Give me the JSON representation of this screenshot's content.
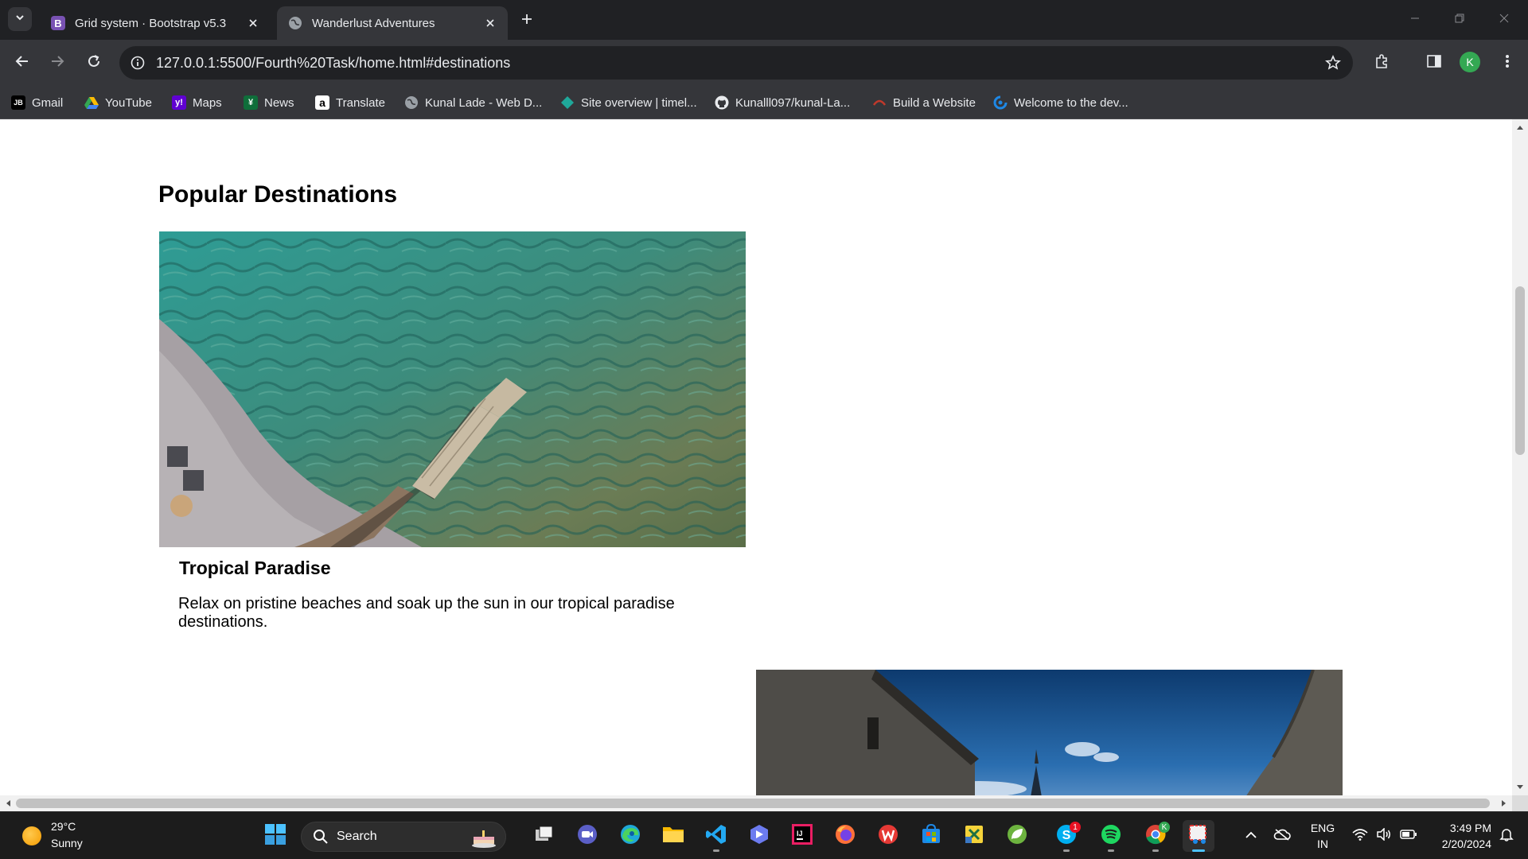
{
  "browser": {
    "tabs": [
      {
        "title": "Grid system · Bootstrap v5.3",
        "icon": "bootstrap-icon",
        "active": false
      },
      {
        "title": "Wanderlust Adventures",
        "icon": "globe-icon",
        "active": true
      }
    ],
    "url": "127.0.0.1:5500/Fourth%20Task/home.html#destinations",
    "profile_initial": "K",
    "bookmarks": [
      {
        "label": "Gmail",
        "icon": "jetbrains-icon"
      },
      {
        "label": "YouTube",
        "icon": "google-drive-icon"
      },
      {
        "label": "Maps",
        "icon": "yahoo-icon"
      },
      {
        "label": "News",
        "icon": "news-icon"
      },
      {
        "label": "Translate",
        "icon": "amazon-icon"
      },
      {
        "label": "Kunal Lade - Web D...",
        "icon": "globe-icon"
      },
      {
        "label": "Site overview | timel...",
        "icon": "diamond-icon"
      },
      {
        "label": "Kunalll097/kunal-La...",
        "icon": "github-icon"
      },
      {
        "label": "Build a Website",
        "icon": "website-builder-icon"
      },
      {
        "label": "Welcome to the dev...",
        "icon": "dev-icon"
      }
    ]
  },
  "page": {
    "section_title": "Popular Destinations",
    "cards": [
      {
        "title": "Tropical Paradise",
        "description": "Relax on pristine beaches and soak up the sun in our tropical paradise destinations.",
        "image": "aerial-beach-pier"
      },
      {
        "title": "",
        "description": "",
        "image": "stone-walls-church-sky"
      }
    ]
  },
  "taskbar": {
    "weather": {
      "temp": "29°C",
      "condition": "Sunny"
    },
    "search_label": "Search",
    "apps": [
      "task-view",
      "teams-meet",
      "edge",
      "file-explorer",
      "vscode",
      "copilot",
      "intellij",
      "firefox",
      "wps-office",
      "ms-store",
      "excel-python",
      "spring",
      "skype",
      "spotify",
      "chrome",
      "snipping-tool"
    ],
    "skype_badge": "1",
    "chrome_badge": "K",
    "language": {
      "line1": "ENG",
      "line2": "IN"
    },
    "clock": {
      "time": "3:49 PM",
      "date": "2/20/2024"
    }
  },
  "colors": {
    "tab_strip": "#202124",
    "toolbar": "#35363a",
    "page_bg": "#ffffff",
    "taskbar": "#1c1c1c",
    "accent_blue": "#4cc2ff"
  }
}
